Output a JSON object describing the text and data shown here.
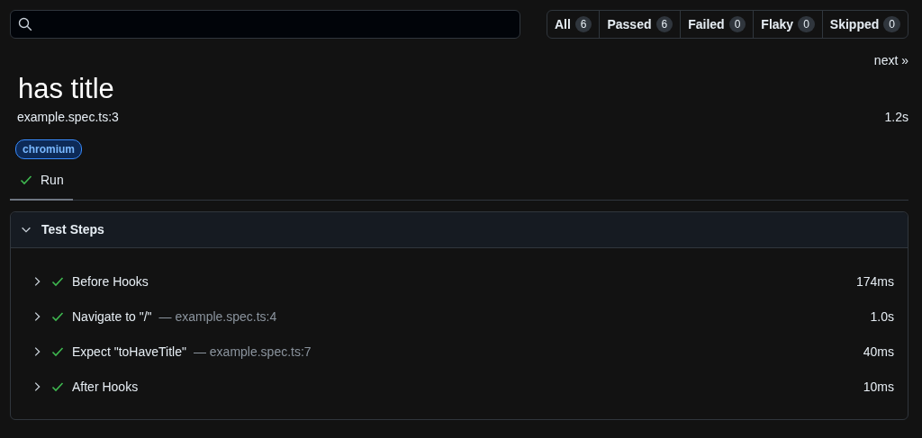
{
  "filters": [
    {
      "label": "All",
      "count": "6",
      "selected": false
    },
    {
      "label": "Passed",
      "count": "6",
      "selected": false
    },
    {
      "label": "Failed",
      "count": "0",
      "selected": false
    },
    {
      "label": "Flaky",
      "count": "0",
      "selected": false
    },
    {
      "label": "Skipped",
      "count": "0",
      "selected": false
    }
  ],
  "next_link": "next »",
  "test": {
    "title": "has title",
    "location": "example.spec.ts:3",
    "duration": "1.2s",
    "tags": [
      "chromium"
    ]
  },
  "tabs": [
    {
      "label": "Run",
      "passed": true,
      "selected": true
    }
  ],
  "steps_section": {
    "title": "Test Steps",
    "expanded": true,
    "steps": [
      {
        "title": "Before Hooks",
        "duration": "174ms",
        "passed": true,
        "expanded": false
      },
      {
        "title": "Navigate to \"/\"",
        "location": "— example.spec.ts:4",
        "duration": "1.0s",
        "passed": true,
        "expanded": false
      },
      {
        "title": "Expect \"toHaveTitle\"",
        "location": "— example.spec.ts:7",
        "duration": "40ms",
        "passed": true,
        "expanded": false
      },
      {
        "title": "After Hooks",
        "duration": "10ms",
        "passed": true,
        "expanded": false
      }
    ]
  }
}
